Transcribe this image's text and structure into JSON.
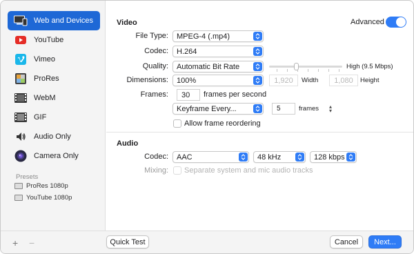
{
  "sidebar": {
    "items": [
      {
        "label": "Web and Devices",
        "icon": "web-devices-icon",
        "selected": true
      },
      {
        "label": "YouTube",
        "icon": "youtube-icon"
      },
      {
        "label": "Vimeo",
        "icon": "vimeo-icon"
      },
      {
        "label": "ProRes",
        "icon": "prores-icon"
      },
      {
        "label": "WebM",
        "icon": "webm-icon"
      },
      {
        "label": "GIF",
        "icon": "gif-icon"
      },
      {
        "label": "Audio Only",
        "icon": "audio-only-icon"
      },
      {
        "label": "Camera Only",
        "icon": "camera-only-icon"
      }
    ],
    "presets_title": "Presets",
    "presets": [
      {
        "label": "ProRes 1080p",
        "icon": "preset-file-icon"
      },
      {
        "label": "YouTube 1080p",
        "icon": "preset-file-icon"
      }
    ]
  },
  "video": {
    "title": "Video",
    "advanced_label": "Advanced",
    "advanced_on": true,
    "file_type_label": "File Type:",
    "file_type_value": "MPEG-4 (.mp4)",
    "codec_label": "Codec:",
    "codec_value": "H.264",
    "quality_label": "Quality:",
    "quality_value": "Automatic Bit Rate",
    "quality_slider_end": "High (9.5 Mbps)",
    "quality_slider_level": 0.37,
    "dimensions_label": "Dimensions:",
    "dimensions_value": "100%",
    "width_value": "1,920",
    "width_label": "Width",
    "height_value": "1,080",
    "height_label": "Height",
    "frames_label": "Frames:",
    "frames_value": "30",
    "frames_unit": "frames per second",
    "keyframe_value": "Keyframe Every...",
    "keyframe_count": "5",
    "keyframe_unit": "frames",
    "reorder_label": "Allow frame reordering"
  },
  "audio": {
    "title": "Audio",
    "codec_label": "Codec:",
    "codec_value": "AAC",
    "sample_rate": "48 kHz",
    "bitrate": "128 kbps",
    "mixing_label": "Mixing:",
    "mixing_option": "Separate system and mic audio tracks"
  },
  "footer": {
    "plus": "+",
    "minus": "−",
    "quick_test": "Quick Test",
    "cancel": "Cancel",
    "next": "Next..."
  },
  "colors": {
    "accent": "#2f7cf6",
    "selection": "#1e68d6"
  }
}
